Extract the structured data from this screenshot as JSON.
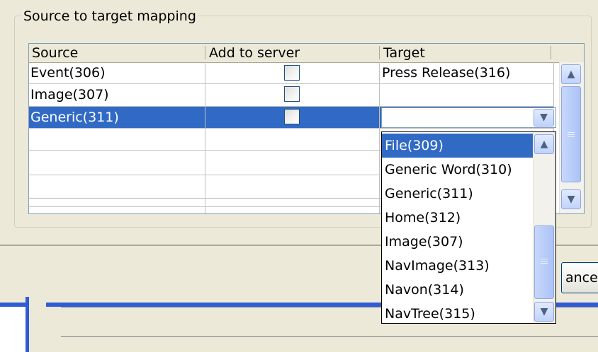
{
  "group": {
    "title": "Source to target mapping"
  },
  "table": {
    "columns": [
      "Source",
      "Add to server",
      "Target"
    ],
    "rows": [
      {
        "source": "Event(306)",
        "checked": false,
        "target": "Press Release(316)"
      },
      {
        "source": "Image(307)",
        "checked": false,
        "target": ""
      },
      {
        "source": "Generic(311)",
        "checked": false,
        "target": "",
        "selected": true
      },
      {
        "source": "",
        "target": ""
      },
      {
        "source": "",
        "target": ""
      },
      {
        "source": "",
        "target": ""
      },
      {
        "source": "",
        "target": ""
      }
    ]
  },
  "dropdown": {
    "options": [
      "File(309)",
      "Generic Word(310)",
      "Generic(311)",
      "Home(312)",
      "Image(307)",
      "NavImage(313)",
      "Navon(314)",
      "NavTree(315)"
    ],
    "highlighted": "File(309)"
  },
  "buttons": {
    "cancel_label": "ancel"
  },
  "icons": {
    "scroll_up": "chevron-up-icon",
    "scroll_down": "chevron-down-icon",
    "combo_arrow": "chevron-down-icon"
  },
  "colors": {
    "selection": "#316ac5",
    "window_bg": "#ece9d8",
    "accent_blue": "#2f5bd6"
  }
}
